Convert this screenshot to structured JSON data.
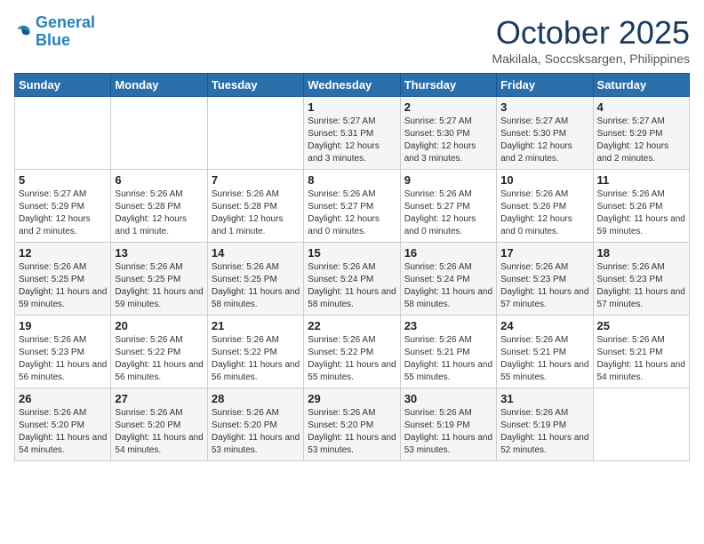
{
  "logo": {
    "line1": "General",
    "line2": "Blue"
  },
  "title": "October 2025",
  "subtitle": "Makilala, Soccsksargen, Philippines",
  "days_of_week": [
    "Sunday",
    "Monday",
    "Tuesday",
    "Wednesday",
    "Thursday",
    "Friday",
    "Saturday"
  ],
  "weeks": [
    [
      {
        "day": "",
        "info": ""
      },
      {
        "day": "",
        "info": ""
      },
      {
        "day": "",
        "info": ""
      },
      {
        "day": "1",
        "info": "Sunrise: 5:27 AM\nSunset: 5:31 PM\nDaylight: 12 hours\nand 3 minutes."
      },
      {
        "day": "2",
        "info": "Sunrise: 5:27 AM\nSunset: 5:30 PM\nDaylight: 12 hours\nand 3 minutes."
      },
      {
        "day": "3",
        "info": "Sunrise: 5:27 AM\nSunset: 5:30 PM\nDaylight: 12 hours\nand 2 minutes."
      },
      {
        "day": "4",
        "info": "Sunrise: 5:27 AM\nSunset: 5:29 PM\nDaylight: 12 hours\nand 2 minutes."
      }
    ],
    [
      {
        "day": "5",
        "info": "Sunrise: 5:27 AM\nSunset: 5:29 PM\nDaylight: 12 hours\nand 2 minutes."
      },
      {
        "day": "6",
        "info": "Sunrise: 5:26 AM\nSunset: 5:28 PM\nDaylight: 12 hours\nand 1 minute."
      },
      {
        "day": "7",
        "info": "Sunrise: 5:26 AM\nSunset: 5:28 PM\nDaylight: 12 hours\nand 1 minute."
      },
      {
        "day": "8",
        "info": "Sunrise: 5:26 AM\nSunset: 5:27 PM\nDaylight: 12 hours\nand 0 minutes."
      },
      {
        "day": "9",
        "info": "Sunrise: 5:26 AM\nSunset: 5:27 PM\nDaylight: 12 hours\nand 0 minutes."
      },
      {
        "day": "10",
        "info": "Sunrise: 5:26 AM\nSunset: 5:26 PM\nDaylight: 12 hours\nand 0 minutes."
      },
      {
        "day": "11",
        "info": "Sunrise: 5:26 AM\nSunset: 5:26 PM\nDaylight: 11 hours\nand 59 minutes."
      }
    ],
    [
      {
        "day": "12",
        "info": "Sunrise: 5:26 AM\nSunset: 5:25 PM\nDaylight: 11 hours\nand 59 minutes."
      },
      {
        "day": "13",
        "info": "Sunrise: 5:26 AM\nSunset: 5:25 PM\nDaylight: 11 hours\nand 59 minutes."
      },
      {
        "day": "14",
        "info": "Sunrise: 5:26 AM\nSunset: 5:25 PM\nDaylight: 11 hours\nand 58 minutes."
      },
      {
        "day": "15",
        "info": "Sunrise: 5:26 AM\nSunset: 5:24 PM\nDaylight: 11 hours\nand 58 minutes."
      },
      {
        "day": "16",
        "info": "Sunrise: 5:26 AM\nSunset: 5:24 PM\nDaylight: 11 hours\nand 58 minutes."
      },
      {
        "day": "17",
        "info": "Sunrise: 5:26 AM\nSunset: 5:23 PM\nDaylight: 11 hours\nand 57 minutes."
      },
      {
        "day": "18",
        "info": "Sunrise: 5:26 AM\nSunset: 5:23 PM\nDaylight: 11 hours\nand 57 minutes."
      }
    ],
    [
      {
        "day": "19",
        "info": "Sunrise: 5:26 AM\nSunset: 5:23 PM\nDaylight: 11 hours\nand 56 minutes."
      },
      {
        "day": "20",
        "info": "Sunrise: 5:26 AM\nSunset: 5:22 PM\nDaylight: 11 hours\nand 56 minutes."
      },
      {
        "day": "21",
        "info": "Sunrise: 5:26 AM\nSunset: 5:22 PM\nDaylight: 11 hours\nand 56 minutes."
      },
      {
        "day": "22",
        "info": "Sunrise: 5:26 AM\nSunset: 5:22 PM\nDaylight: 11 hours\nand 55 minutes."
      },
      {
        "day": "23",
        "info": "Sunrise: 5:26 AM\nSunset: 5:21 PM\nDaylight: 11 hours\nand 55 minutes."
      },
      {
        "day": "24",
        "info": "Sunrise: 5:26 AM\nSunset: 5:21 PM\nDaylight: 11 hours\nand 55 minutes."
      },
      {
        "day": "25",
        "info": "Sunrise: 5:26 AM\nSunset: 5:21 PM\nDaylight: 11 hours\nand 54 minutes."
      }
    ],
    [
      {
        "day": "26",
        "info": "Sunrise: 5:26 AM\nSunset: 5:20 PM\nDaylight: 11 hours\nand 54 minutes."
      },
      {
        "day": "27",
        "info": "Sunrise: 5:26 AM\nSunset: 5:20 PM\nDaylight: 11 hours\nand 54 minutes."
      },
      {
        "day": "28",
        "info": "Sunrise: 5:26 AM\nSunset: 5:20 PM\nDaylight: 11 hours\nand 53 minutes."
      },
      {
        "day": "29",
        "info": "Sunrise: 5:26 AM\nSunset: 5:20 PM\nDaylight: 11 hours\nand 53 minutes."
      },
      {
        "day": "30",
        "info": "Sunrise: 5:26 AM\nSunset: 5:19 PM\nDaylight: 11 hours\nand 53 minutes."
      },
      {
        "day": "31",
        "info": "Sunrise: 5:26 AM\nSunset: 5:19 PM\nDaylight: 11 hours\nand 52 minutes."
      },
      {
        "day": "",
        "info": ""
      }
    ]
  ]
}
